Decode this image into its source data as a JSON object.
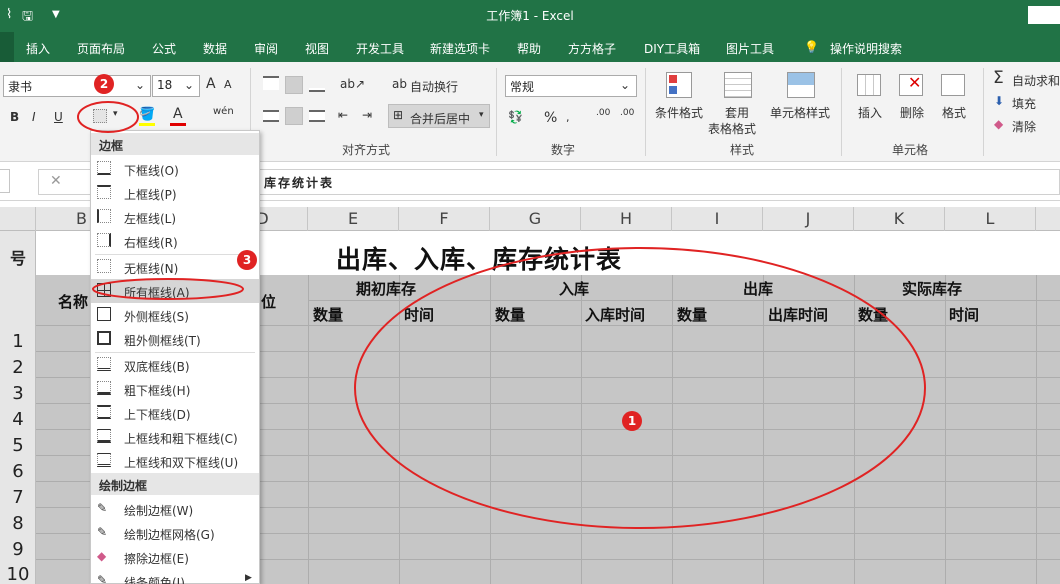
{
  "window": {
    "title": "工作簿1  -  Excel"
  },
  "tabs": [
    "插入",
    "页面布局",
    "公式",
    "数据",
    "审阅",
    "视图",
    "开发工具",
    "新建选项卡",
    "帮助",
    "方方格子",
    "DIY工具箱",
    "图片工具",
    "操作说明搜索"
  ],
  "ribbon": {
    "font_name": "隶书",
    "font_size": "18",
    "bold": "B",
    "italic": "I",
    "underline": "U",
    "wrap_text": "自动换行",
    "merge_center": "合并后居中",
    "align_group": "对齐方式",
    "number_format": "常规",
    "number_group": "数字",
    "percent": "%",
    "cond_format": "条件格式",
    "table_format_1": "套用",
    "table_format_2": "表格格式",
    "cell_style": "单元格样式",
    "style_group": "样式",
    "insert": "插入",
    "delete": "删除",
    "format": "格式",
    "cells_group": "单元格",
    "autosum": "自动求和",
    "fill": "填充",
    "clear": "清除"
  },
  "formula": {
    "content": "库存统计表"
  },
  "columns": [
    "B",
    "D",
    "E",
    "F",
    "G",
    "H",
    "I",
    "J",
    "K",
    "L"
  ],
  "rows": [
    "1",
    "2",
    "3",
    "4",
    "5",
    "6",
    "7",
    "8",
    "9",
    "10"
  ],
  "sheet": {
    "title": "出库、入库、库存统计表",
    "col_a_frag": "号",
    "col_b_frag": "名称",
    "col_d_frag": "位",
    "groups": [
      "期初库存",
      "入库",
      "出库",
      "实际库存"
    ],
    "subheaders": [
      "数量",
      "时间",
      "数量",
      "入库时间",
      "数量",
      "出库时间",
      "数量",
      "时间"
    ]
  },
  "dropdown": {
    "header_border": "边框",
    "items1": [
      "下框线(O)",
      "上框线(P)",
      "左框线(L)",
      "右框线(R)"
    ],
    "items2": [
      "无框线(N)",
      "所有框线(A)",
      "外侧框线(S)",
      "粗外侧框线(T)"
    ],
    "items3": [
      "双底框线(B)",
      "粗下框线(H)",
      "上下框线(D)",
      "上框线和粗下框线(C)",
      "上框线和双下框线(U)"
    ],
    "header_draw": "绘制边框",
    "items4": [
      "绘制边框(W)",
      "绘制边框网格(G)",
      "擦除边框(E)",
      "线条颜色(I)"
    ]
  },
  "annotations": [
    "1",
    "2",
    "3"
  ],
  "colors": {
    "excel_green": "#217346",
    "annotation_red": "#e02323",
    "shaded_fill": "#c6c6c6"
  }
}
